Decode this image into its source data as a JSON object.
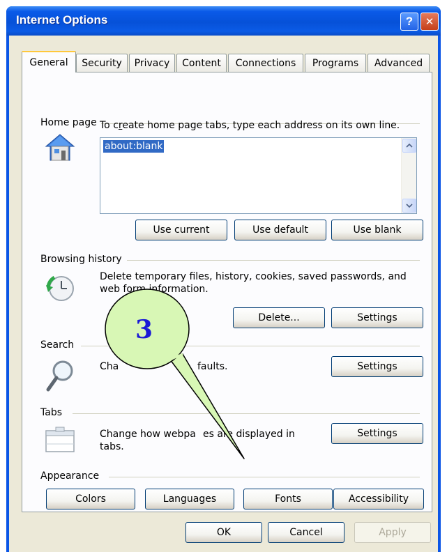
{
  "window": {
    "title": "Internet Options"
  },
  "titlebar": {
    "help_glyph": "?",
    "close_glyph": "✕"
  },
  "tabs": [
    {
      "label": "General",
      "active": true
    },
    {
      "label": "Security"
    },
    {
      "label": "Privacy"
    },
    {
      "label": "Content"
    },
    {
      "label": "Connections"
    },
    {
      "label": "Programs"
    },
    {
      "label": "Advanced"
    }
  ],
  "home_page": {
    "heading": "Home page",
    "instructions": "To create home page tabs, type each address on its own line.",
    "addresses": "about:blank",
    "use_current": "Use current",
    "use_default": "Use default",
    "use_blank": "Use blank"
  },
  "browsing_history": {
    "heading": "Browsing history",
    "description": "Delete temporary files, history, cookies, saved passwords, and web form information.",
    "delete_label": "Delete...",
    "settings_label": "Settings"
  },
  "search": {
    "heading": "Search",
    "description_visible": "Cha",
    "description_tail": "faults.",
    "settings_label": "Settings"
  },
  "tabs_section": {
    "heading": "Tabs",
    "description_part1": "Change how webpa",
    "description_part2": "es are displayed in",
    "description_line2": "tabs.",
    "settings_label": "Settings"
  },
  "appearance": {
    "heading": "Appearance",
    "colors": "Colors",
    "languages": "Languages",
    "fonts": "Fonts",
    "accessibility": "Accessibility"
  },
  "footer": {
    "ok": "OK",
    "cancel": "Cancel",
    "apply": "Apply"
  },
  "callout": {
    "number": "3",
    "fill": "#d8f7b5",
    "stroke": "#000000",
    "text_color": "#1a1ad6"
  },
  "colors": {
    "titlebar": "#0a55e6",
    "client": "#ece9d8",
    "active_tab_accent": "#ffc83c",
    "selection": "#316ac5"
  }
}
